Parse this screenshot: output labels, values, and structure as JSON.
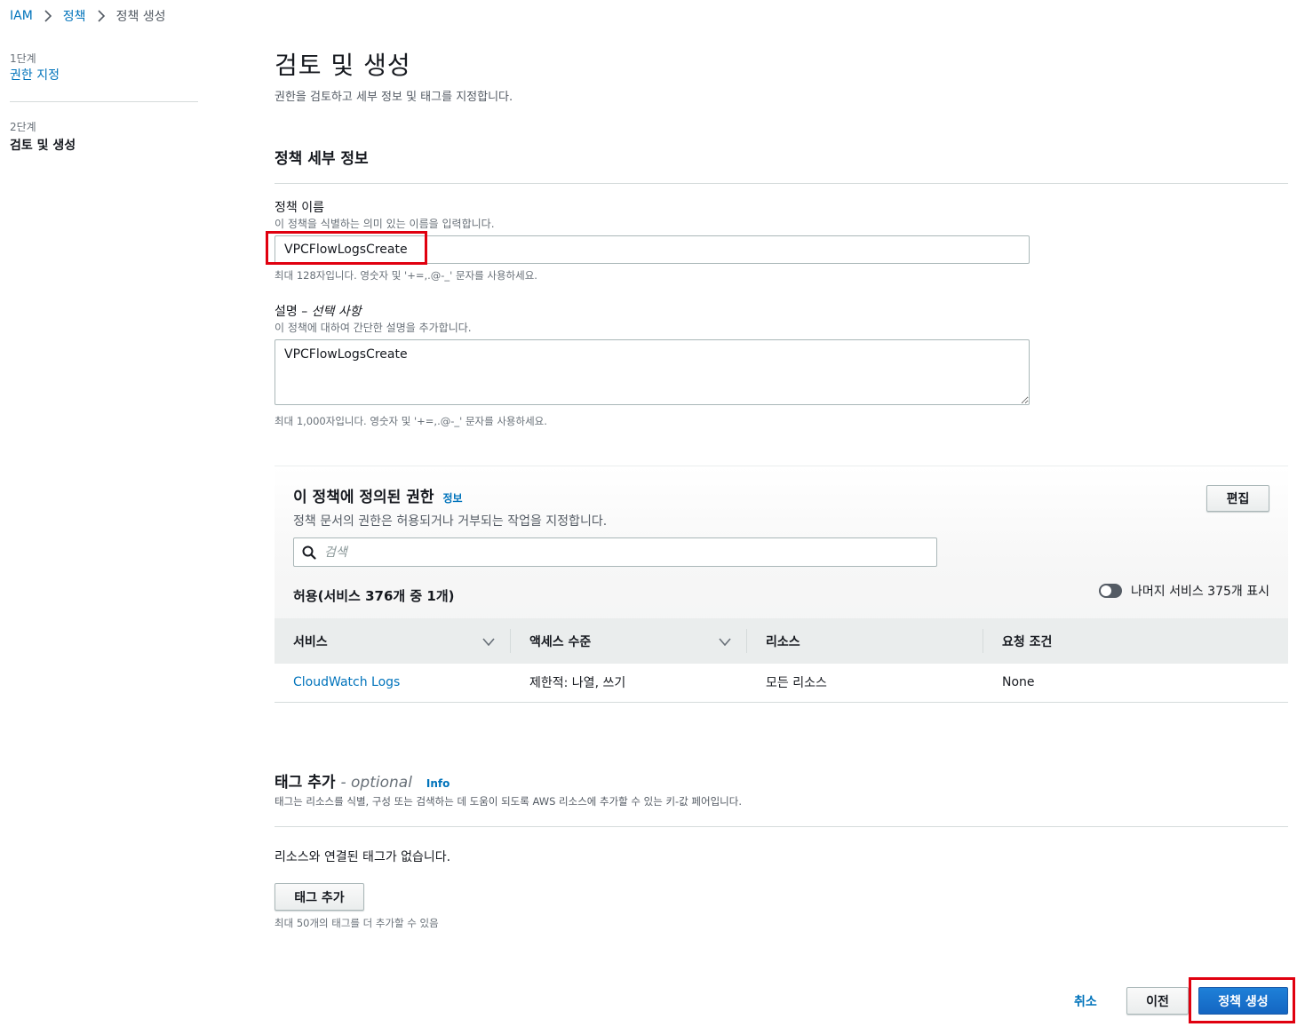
{
  "breadcrumb": {
    "items": [
      "IAM",
      "정책"
    ],
    "current": "정책 생성"
  },
  "steps": [
    {
      "num": "1단계",
      "label": "권한 지정"
    },
    {
      "num": "2단계",
      "label": "검토 및 생성"
    }
  ],
  "page": {
    "title": "검토 및 생성",
    "description": "권한을 검토하고 세부 정보 및 태그를 지정합니다."
  },
  "policy_details": {
    "title": "정책 세부 정보",
    "name": {
      "label": "정책 이름",
      "description": "이 정책을 식별하는 의미 있는 이름을 입력합니다.",
      "value": "VPCFlowLogsCreate",
      "constraint": "최대 128자입니다. 영숫자 및 '+=,.@-_' 문자를 사용하세요."
    },
    "desc": {
      "label": "설명 –",
      "label_optional": "선택 사항",
      "description": "이 정책에 대하여 간단한 설명을 추가합니다.",
      "value": "VPCFlowLogsCreate",
      "constraint": "최대 1,000자입니다. 영숫자 및 '+=,.@-_' 문자를 사용하세요."
    }
  },
  "permissions": {
    "title": "이 정책에 정의된 권한",
    "info": "정보",
    "description": "정책 문서의 권한은 허용되거나 거부되는 작업을 지정합니다.",
    "edit_label": "편집",
    "search_placeholder": "검색",
    "allow_count": "허용(서비스 376개 중 1개)",
    "toggle_label": "나머지 서비스 375개 표시",
    "toggle_on": false,
    "columns": [
      "서비스",
      "액세스 수준",
      "리소스",
      "요청 조건"
    ],
    "rows": [
      {
        "service": "CloudWatch Logs",
        "access": "제한적: 나열, 쓰기",
        "resource": "모든 리소스",
        "condition": "None"
      }
    ]
  },
  "tags": {
    "title": "태그 추가",
    "optional": "- optional",
    "info": "Info",
    "description": "태그는 리소스를 식별, 구성 또는 검색하는 데 도움이 되도록 AWS 리소스에 추가할 수 있는 키-값 페어입니다.",
    "empty_text": "리소스와 연결된 태그가 없습니다.",
    "add_label": "태그 추가",
    "limit_text": "최대 50개의 태그를 더 추가할 수 있음"
  },
  "footer": {
    "cancel_label": "취소",
    "prev_label": "이전",
    "create_label": "정책 생성"
  },
  "colors": {
    "link": "#0073bb",
    "primary_button": "#1466c2",
    "highlight": "#e0000f"
  }
}
